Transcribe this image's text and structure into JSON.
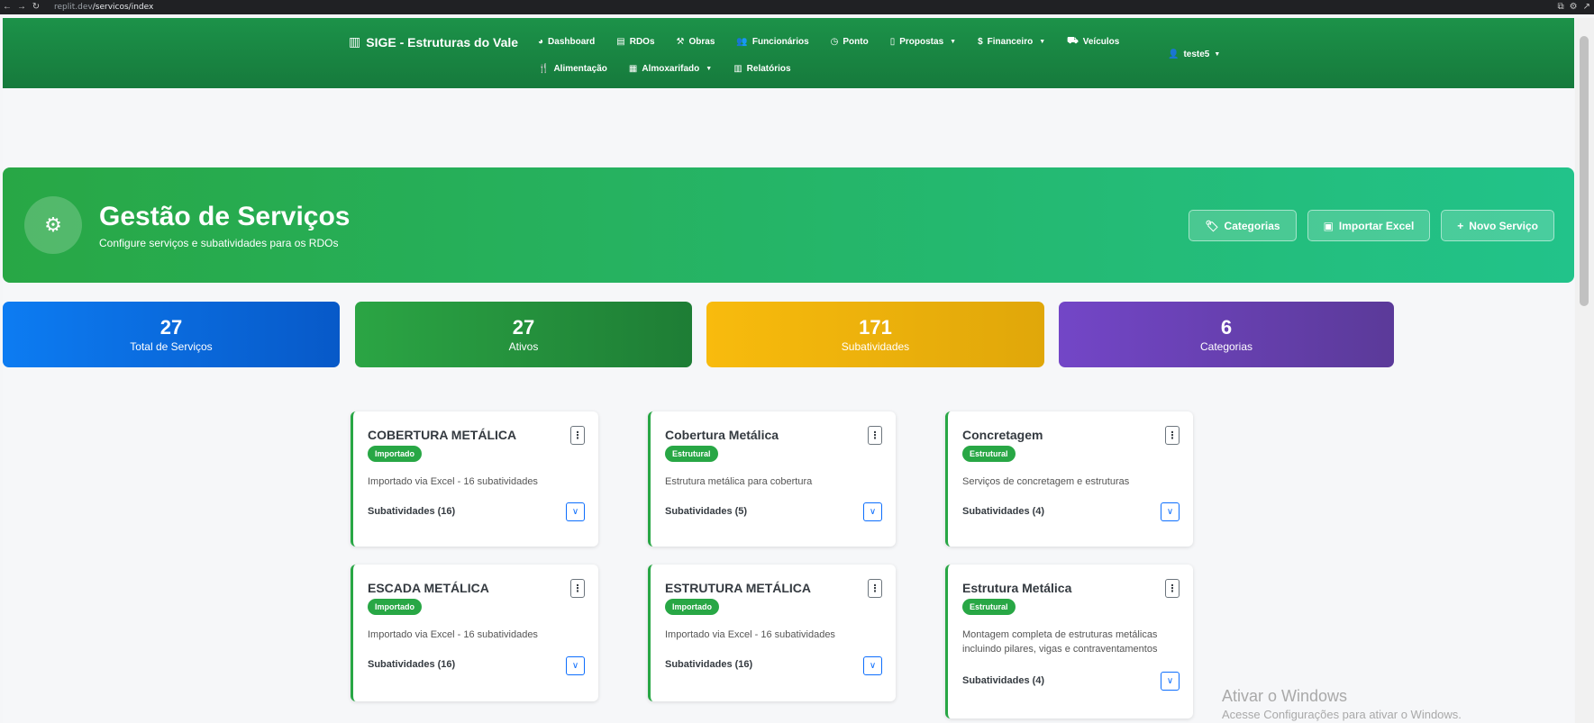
{
  "browser": {
    "url_prefix": "replit.dev",
    "url_path": "/servicos/index",
    "back_icon": "back-arrow-icon",
    "forward_icon": "forward-arrow-icon",
    "reload_icon": "reload-icon"
  },
  "navbar": {
    "brand": "SIGE - Estruturas do Vale",
    "items_row1": [
      {
        "label": "Dashboard",
        "icon": "dashboard-icon",
        "glyph": "◕",
        "caret": false
      },
      {
        "label": "RDOs",
        "icon": "clipboard-icon",
        "glyph": "▤",
        "caret": false
      },
      {
        "label": "Obras",
        "icon": "hammer-icon",
        "glyph": "⚒",
        "caret": false
      },
      {
        "label": "Funcionários",
        "icon": "users-icon",
        "glyph": "👥",
        "caret": false
      },
      {
        "label": "Ponto",
        "icon": "clock-icon",
        "glyph": "◷",
        "caret": false
      },
      {
        "label": "Propostas",
        "icon": "file-icon",
        "glyph": "▯",
        "caret": true
      },
      {
        "label": "Financeiro",
        "icon": "dollar-icon",
        "glyph": "$",
        "caret": true
      },
      {
        "label": "Veículos",
        "icon": "car-icon",
        "glyph": "⛟",
        "caret": false
      }
    ],
    "items_row2": [
      {
        "label": "Alimentação",
        "icon": "utensils-icon",
        "glyph": "🍴",
        "caret": false
      },
      {
        "label": "Almoxarifado",
        "icon": "boxes-icon",
        "glyph": "▦",
        "caret": true
      },
      {
        "label": "Relatórios",
        "icon": "chart-icon",
        "glyph": "▥",
        "caret": false
      }
    ],
    "user": "teste5"
  },
  "hero": {
    "title": "Gestão de Serviços",
    "subtitle": "Configure serviços e subatividades para os RDOs",
    "buttons": {
      "categorias": "Categorias",
      "importar": "Importar Excel",
      "novo": "Novo Serviço"
    }
  },
  "stats": [
    {
      "value": "27",
      "label": "Total de Serviços"
    },
    {
      "value": "27",
      "label": "Ativos"
    },
    {
      "value": "171",
      "label": "Subatividades"
    },
    {
      "value": "6",
      "label": "Categorias"
    }
  ],
  "services": [
    {
      "title": "COBERTURA METÁLICA",
      "badge": "Importado",
      "description": "Importado via Excel - 16 subatividades",
      "subs": "Subatividades (16)"
    },
    {
      "title": "Cobertura Metálica",
      "badge": "Estrutural",
      "description": "Estrutura metálica para cobertura",
      "subs": "Subatividades (5)"
    },
    {
      "title": "Concretagem",
      "badge": "Estrutural",
      "description": "Serviços de concretagem e estruturas",
      "subs": "Subatividades (4)"
    },
    {
      "title": "ESCADA METÁLICA",
      "badge": "Importado",
      "description": "Importado via Excel - 16 subatividades",
      "subs": "Subatividades (16)"
    },
    {
      "title": "ESTRUTURA METÁLICA",
      "badge": "Importado",
      "description": "Importado via Excel - 16 subatividades",
      "subs": "Subatividades (16)"
    },
    {
      "title": "Estrutura Metálica",
      "badge": "Estrutural",
      "description": "Montagem completa de estruturas metálicas incluindo pilares, vigas e contraventamentos",
      "subs": "Subatividades (4)"
    }
  ],
  "watermark": {
    "title": "Ativar o Windows",
    "subtitle": "Acesse Configurações para ativar o Windows."
  },
  "colors": {
    "primary_green": "#28a745",
    "navbar_green": "#167a3c",
    "blue": "#0d6efd",
    "yellow": "#f8bb0d",
    "purple": "#7346c7"
  }
}
